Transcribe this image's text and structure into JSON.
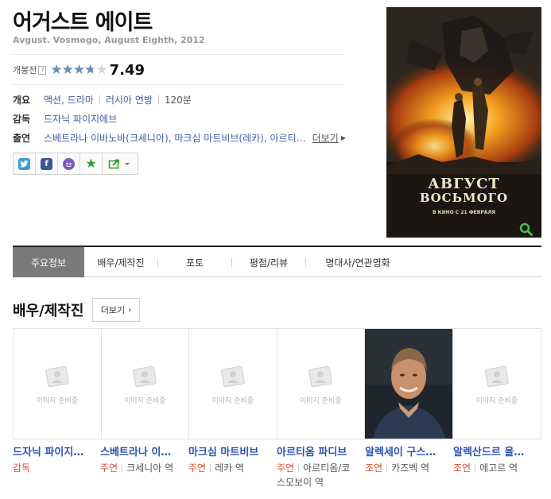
{
  "movie": {
    "title": "어거스트 에이트",
    "original_title": "Avgust. Vosmogo, August Eighth, 2012"
  },
  "rating": {
    "label": "개봉전",
    "help_glyph": "?",
    "score": "7.49",
    "score_fraction": 0.749,
    "stars_glyph": "★★★★★"
  },
  "info": {
    "overview": {
      "label": "개요",
      "genre": "액션, 드라마",
      "country": "러시아 연방",
      "runtime": "120분"
    },
    "director": {
      "label": "감독",
      "name": "드자닉 파이지에브"
    },
    "cast": {
      "label": "출연",
      "text": "스베트라나 이바노바(크세니아), 마크심 마트비브(레카), 아르티…",
      "more_label": "더보기"
    }
  },
  "share": {
    "icons": [
      "twitter-icon",
      "facebook-icon",
      "me2day-icon",
      "favorite-star-icon",
      "share-export-icon"
    ],
    "colors": {
      "twitter": "#3a9fd8",
      "facebook": "#3b5998",
      "me2day": "#7b5cb8",
      "star": "#2f9a2f"
    }
  },
  "poster": {
    "title_line1": "АВГУСТ",
    "title_line2": "ВОСЬМОГО",
    "tagline": "В КИНО С 21 ФЕВРАЛЯ"
  },
  "tabs": [
    {
      "label": "주요정보",
      "active": true
    },
    {
      "label": "배우/제작진",
      "active": false
    },
    {
      "label": "포토",
      "active": false
    },
    {
      "label": "평점/리뷰",
      "active": false
    },
    {
      "label": "명대사/연관영화",
      "active": false
    }
  ],
  "cast_section": {
    "title": "배우/제작진",
    "more_label": "더보기",
    "placeholder_text": "이미지 준비중",
    "members": [
      {
        "name": "드자닉 파이지…",
        "role_type": "감독",
        "role": ""
      },
      {
        "name": "스베트라나 이…",
        "role_type": "주연",
        "role": "크세니아 역"
      },
      {
        "name": "마크심 마트비브",
        "role_type": "주연",
        "role": "레카 역"
      },
      {
        "name": "아르티옴 파디브",
        "role_type": "주연",
        "role": "아르티옴/코스모보이 역"
      },
      {
        "name": "알렉세이 구스…",
        "role_type": "조연",
        "role": "카즈벡 역"
      },
      {
        "name": "알렉산드르 올…",
        "role_type": "조연",
        "role": "에고르 역"
      }
    ]
  },
  "colors": {
    "link": "#3d5fa8",
    "role_type": "#d9532d",
    "active_tab": "#7a7a7a",
    "star_fill": "#6b8fb3"
  }
}
